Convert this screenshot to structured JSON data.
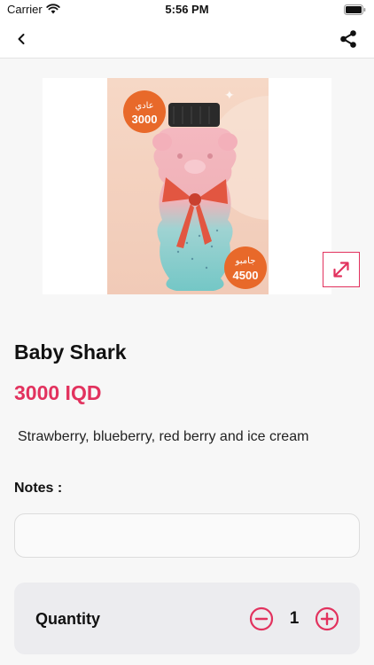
{
  "status_bar": {
    "carrier": "Carrier",
    "time": "5:56 PM"
  },
  "nav": {
    "back_icon": "chevron-left-icon",
    "share_icon": "share-icon"
  },
  "product": {
    "image_badges": {
      "regular_label": "عادي",
      "regular_price": "3000",
      "jumbo_label": "جامبو",
      "jumbo_price": "4500"
    },
    "expand_icon": "expand-arrows-icon",
    "name": "Baby Shark",
    "price": "3000 IQD",
    "description": "Strawberry, blueberry, red berry and ice cream"
  },
  "notes": {
    "label": "Notes :",
    "value": "",
    "placeholder": ""
  },
  "quantity": {
    "label": "Quantity",
    "value": "1",
    "decrement_icon": "minus-circle-icon",
    "increment_icon": "plus-circle-icon"
  },
  "colors": {
    "accent": "#e2325e",
    "photo_background": "#f4d3c2",
    "badge": "#e8692a"
  }
}
